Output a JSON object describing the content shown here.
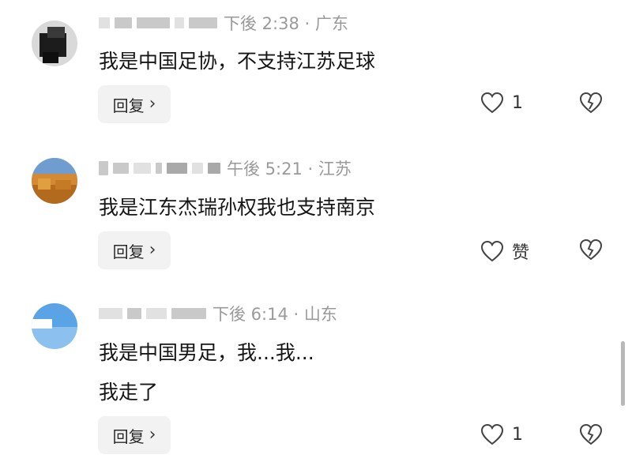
{
  "comments": [
    {
      "meta_suffix": "下後 2:38 · 广东",
      "lines": [
        "我是中国足协，不支持江苏足球"
      ],
      "reply_label": "回复",
      "like_label": "1",
      "avatar_icon": "dark-blurred-avatar-icon"
    },
    {
      "meta_suffix": "午後 5:21 · 江苏",
      "lines": [
        "我是江东杰瑞孙权我也支持南京"
      ],
      "reply_label": "回复",
      "like_label": "赞",
      "avatar_icon": "sunset-landscape-avatar-icon"
    },
    {
      "meta_suffix": "下後 6:14 · 山东",
      "lines": [
        "我是中国男足，我...我...",
        "我走了"
      ],
      "reply_label": "回复",
      "like_label": "1",
      "avatar_icon": "blue-sky-avatar-icon"
    }
  ],
  "icons": {
    "like": "heart-outline-icon",
    "dislike": "broken-heart-icon",
    "chevron": "chevron-right-icon"
  },
  "colors": {
    "meta_text": "#9a9a9a",
    "reply_bg": "#f2f2f2",
    "body_text": "#161616"
  }
}
